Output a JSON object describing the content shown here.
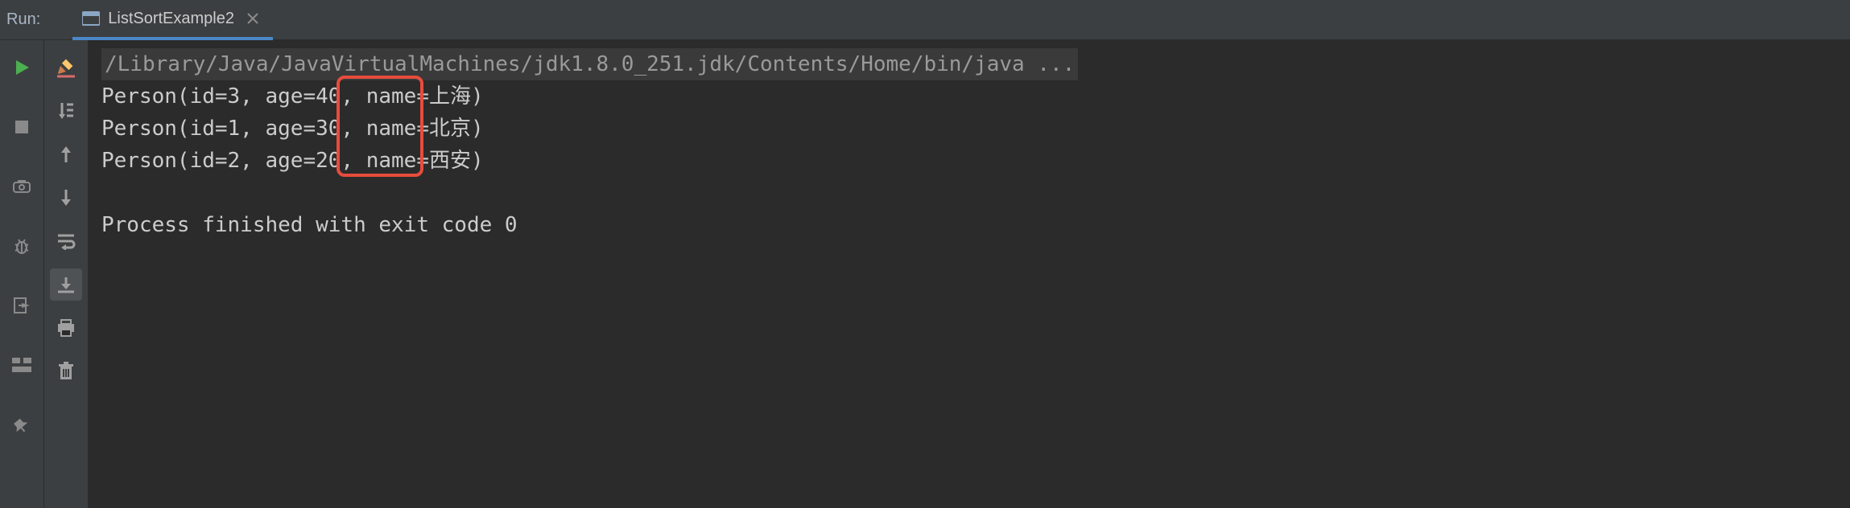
{
  "header": {
    "run_label": "Run:",
    "tab_label": "ListSortExample2"
  },
  "console": {
    "command": "/Library/Java/JavaVirtualMachines/jdk1.8.0_251.jdk/Contents/Home/bin/java ...",
    "lines": [
      "Person(id=3, age=40, name=上海)",
      "Person(id=1, age=30, name=北京)",
      "Person(id=2, age=20, name=西安)"
    ],
    "exit": "Process finished with exit code 0"
  },
  "icons": {
    "run": "run-icon",
    "stop": "stop-icon",
    "camera": "camera-icon",
    "debug": "debug-icon",
    "exit": "exit-icon",
    "layout": "layout-icon",
    "pin": "pin-icon",
    "edit": "edit-icon",
    "steps": "steps-icon",
    "up": "up-icon",
    "down": "down-icon",
    "wrap": "wrap-icon",
    "scroll": "scroll-icon",
    "print": "print-icon",
    "trash": "trash-icon"
  }
}
